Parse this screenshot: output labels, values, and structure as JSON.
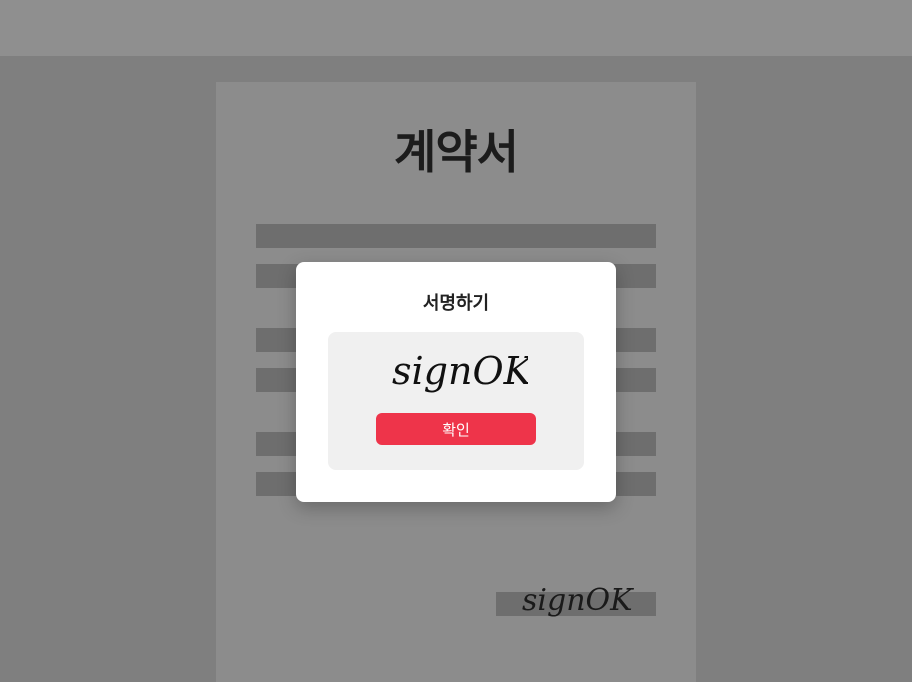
{
  "document": {
    "title": "계약서",
    "signature_text": "signOK"
  },
  "modal": {
    "title": "서명하기",
    "signature_text": "signOK",
    "confirm_label": "확인"
  },
  "colors": {
    "accent": "#ee344a",
    "overlay": "#8a8a8a",
    "modal_bg": "#ffffff",
    "pad_bg": "#f0f0f0"
  }
}
